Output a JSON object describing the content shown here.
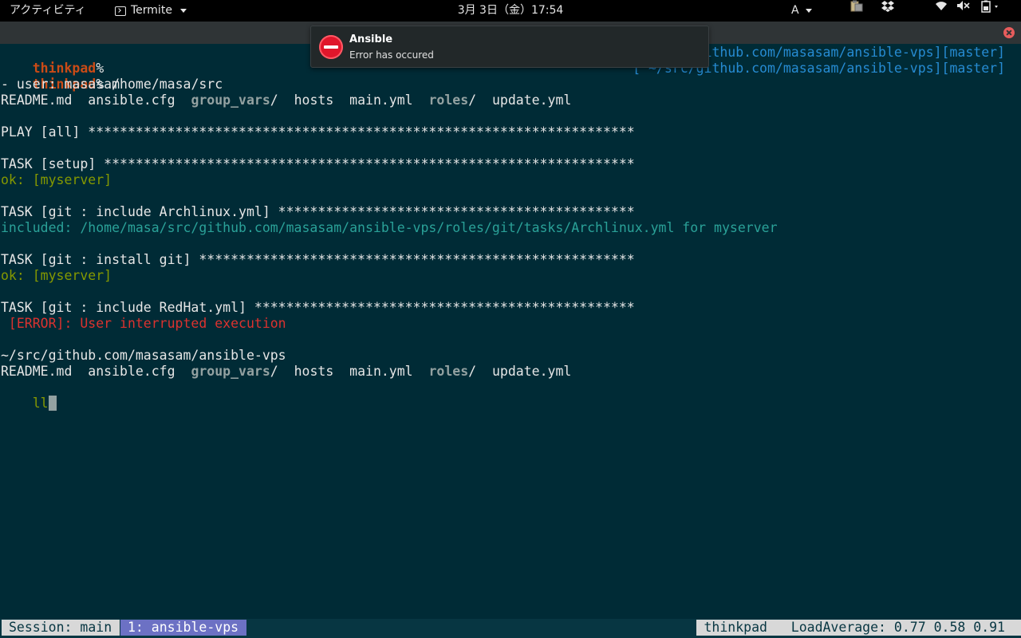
{
  "topbar": {
    "activities": "アクティビティ",
    "app_name": "Termite",
    "clock": "3月 3日（金）17:54",
    "input_method": "A",
    "icons": [
      "clipboard-icon",
      "dropbox-icon",
      "wifi-icon",
      "volume-muted-icon",
      "battery-icon"
    ]
  },
  "notification": {
    "title": "Ansible",
    "body": "Error has occured",
    "icon": "error-stop-icon",
    "icon_color": "#e0162b"
  },
  "terminal": {
    "right_prompts": [
      "~/src/github.com/masasam/ansible-vps][master]",
      "[ ~/src/github.com/masasam/ansible-vps][master]"
    ],
    "l1": {
      "host": "thinkpad",
      "sym": "%"
    },
    "l2": {
      "host": "thinkpad",
      "sym": "%",
      "text": " /home/masa/src"
    },
    "l3": "- user: masasam",
    "ls1": {
      "readme": "README.md",
      "cfg": "ansible.cfg",
      "group_vars": "group_vars",
      "hosts": "hosts",
      "main": "main.yml",
      "roles": "roles",
      "update": "update.yml"
    },
    "play": "PLAY [all] *********************************************************************",
    "task_setup": "TASK [setup] *******************************************************************",
    "ok1": "ok: [myserver]",
    "task_include_arch": "TASK [git : include Archlinux.yml] *********************************************",
    "included": "included: /home/masa/src/github.com/masasam/ansible-vps/roles/git/tasks/Archlinux.yml for myserver",
    "task_install_git": "TASK [git : install git] *******************************************************",
    "ok2": "ok: [myserver]",
    "task_include_redhat": "TASK [git : include RedHat.yml] ************************************************",
    "error": " [ERROR]: User interrupted execution",
    "cwd": "~/src/github.com/masasam/ansible-vps",
    "ls2": {
      "readme": "README.md",
      "cfg": "ansible.cfg",
      "group_vars": "group_vars",
      "hosts": "hosts",
      "main": "main.yml",
      "roles": "roles",
      "update": "update.yml"
    },
    "typed": "ll"
  },
  "statusbar": {
    "session": "Session: main",
    "window": "1: ansible-vps",
    "host": "thinkpad",
    "load_label": "LoadAverage:",
    "load_values": "0.77 0.58 0.91"
  },
  "colors": {
    "background": "#002b36",
    "prompt": "#cb4b16",
    "ok": "#859900",
    "included": "#2aa198",
    "git_prompt": "#268bd2",
    "error": "#dc322f",
    "tmux_window": "#6c71c4"
  }
}
